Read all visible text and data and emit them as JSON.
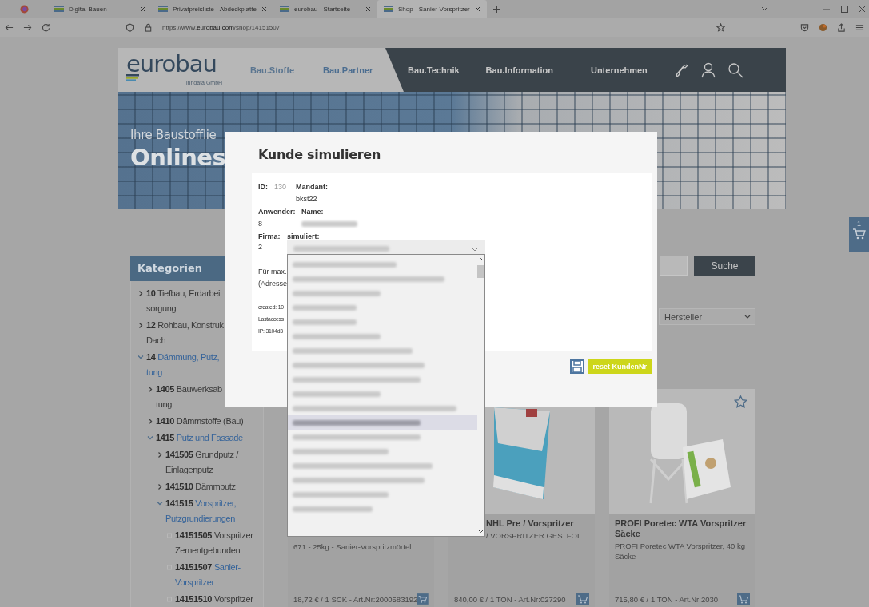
{
  "browser": {
    "tabs": [
      {
        "title": "Digital Bauen",
        "selected": false
      },
      {
        "title": "Privatpreisliste - Abdeckplatte",
        "selected": false
      },
      {
        "title": "eurobau - Startseite",
        "selected": false
      },
      {
        "title": "Shop - Sanier-Vorspritzer",
        "selected": true
      }
    ],
    "url": "https://www.**eurobau.com**/shop/14151507"
  },
  "header": {
    "logo": "eurobau",
    "logo_subtitle": "inndata GmbH",
    "nav_light": [
      "Bau.Stoffe",
      "Bau.Partner"
    ],
    "nav_dark": [
      "Bau.Technik",
      "Bau.Information",
      "Unternehmen"
    ]
  },
  "hero": {
    "tagline": "Ihre Baustofflie",
    "headline": "Onlines"
  },
  "cart_tab": {
    "count": "1"
  },
  "sidebar": {
    "title": "Kategorien",
    "items": [
      {
        "kind": "branch",
        "code": "10",
        "lines": [
          "Tiefbau, Erdarbei",
          "sorgung"
        ],
        "expanded": false
      },
      {
        "kind": "branch",
        "code": "12",
        "lines": [
          "Rohbau, Konstruk",
          "Dach"
        ],
        "expanded": false
      },
      {
        "kind": "branch",
        "code": "14",
        "lines": [
          "Dämmung, Putz,",
          "tung"
        ],
        "expanded": true,
        "children": [
          {
            "kind": "branch",
            "code": "1405",
            "lines": [
              "Bauwerksab",
              "tung"
            ],
            "expanded": false
          },
          {
            "kind": "branch",
            "code": "1410",
            "lines": [
              "Dämmstoffe (Bau)"
            ],
            "expanded": false
          },
          {
            "kind": "branch",
            "code": "1415",
            "lines": [
              "Putz und Fassade"
            ],
            "expanded": true,
            "children": [
              {
                "kind": "branch",
                "code": "141505",
                "lines": [
                  "Grundputz /",
                  "Einlagenputz"
                ],
                "expanded": false
              },
              {
                "kind": "branch",
                "code": "141510",
                "lines": [
                  "Dämmputz"
                ],
                "expanded": false
              },
              {
                "kind": "branch",
                "code": "141515",
                "lines": [
                  "Vorspritzer,",
                  "Putzgrundierungen"
                ],
                "expanded": true,
                "children": [
                  {
                    "kind": "leaf",
                    "code": "14151505",
                    "lines": [
                      "Vorspritzer",
                      "Zementgebunden"
                    ],
                    "selected": false
                  },
                  {
                    "kind": "leaf",
                    "code": "14151507",
                    "lines": [
                      "Sanier-",
                      "Vorspritzer"
                    ],
                    "selected": true
                  },
                  {
                    "kind": "leaf",
                    "code": "14151510",
                    "lines": [
                      "Vorspritzer"
                    ],
                    "selected": false
                  }
                ]
              }
            ]
          }
        ]
      }
    ]
  },
  "shop": {
    "search_button": "Suche",
    "manufacturer_select": "Hersteller",
    "products": [
      {
        "subtitle": "671 - 25kg - Sanier-Vorspritzmörtel",
        "price": "18,72 € / 1 SCK - Art.Nr:2000583192"
      },
      {
        "kind": "bag",
        "title": "NHL Pre / Vorspritzer",
        "subtitle": "/ VORSPRITZER GES. FOL.",
        "price": "840,00 € / 1 TON - Art.Nr:027290"
      },
      {
        "kind": "silo",
        "favorite_star": true,
        "title": "PROFI Poretec WTA Vorspritzer Säcke",
        "subtitle": "PROFI Poretec WTA Vorspritzer, 40 kg Säcke",
        "price": "715,80 € / 1 TON - Art.Nr:2030"
      }
    ]
  },
  "modal": {
    "title": "Kunde simulieren",
    "id_label": "ID:",
    "id_value": "130",
    "client_label": "Mandant:",
    "client_value": "bkst22",
    "user_label": "Anwender:",
    "name_label": "Name:",
    "user_value": "8",
    "company_label": "Firma:",
    "simulated_label": "simuliert:",
    "company_value": "2",
    "customer_select": {
      "expanded": true,
      "options": [
        {
          "selected": false
        },
        {
          "selected": false
        },
        {
          "selected": false
        },
        {
          "selected": false
        },
        {
          "selected": false
        },
        {
          "selected": false
        },
        {
          "selected": false
        },
        {
          "selected": false
        },
        {
          "selected": false
        },
        {
          "selected": false
        },
        {
          "selected": false
        },
        {
          "selected": true
        },
        {
          "selected": false
        },
        {
          "selected": false
        },
        {
          "selected": false
        },
        {
          "selected": false
        },
        {
          "selected": false
        },
        {
          "selected": false
        }
      ]
    },
    "note_lines": [
      "Für max.",
      "(Adresse"
    ],
    "meta_lines": [
      "created: 10",
      "Lastaccess",
      "IP: 3104d3"
    ],
    "reset_button": "reset KundenNr"
  }
}
